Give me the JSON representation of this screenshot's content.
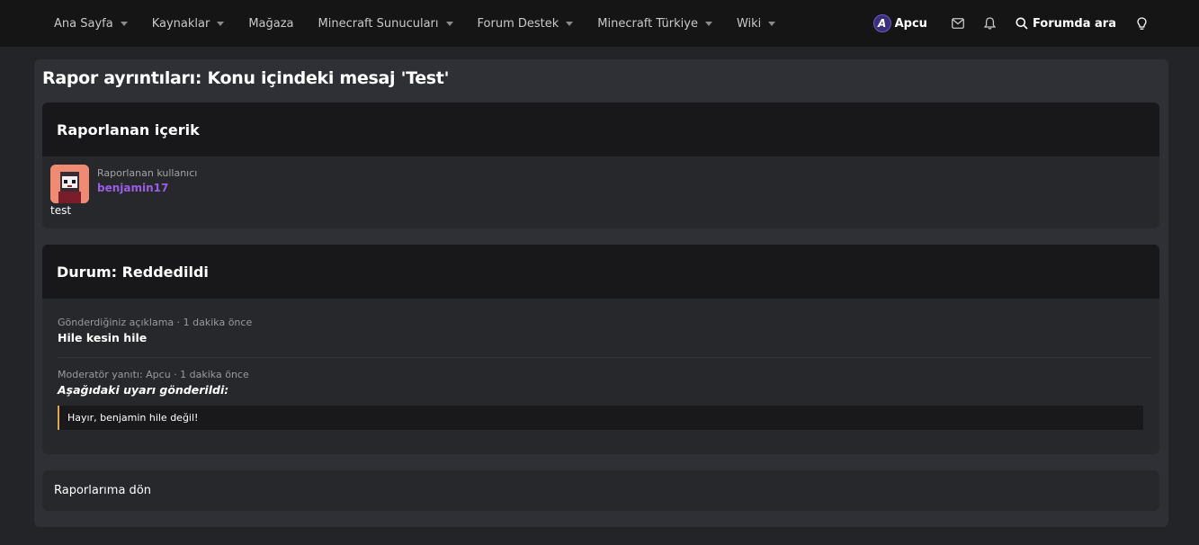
{
  "nav": {
    "items": [
      {
        "label": "Ana Sayfa",
        "has_dropdown": true
      },
      {
        "label": "Kaynaklar",
        "has_dropdown": true
      },
      {
        "label": "Mağaza",
        "has_dropdown": false
      },
      {
        "label": "Minecraft Sunucuları",
        "has_dropdown": true
      },
      {
        "label": "Forum Destek",
        "has_dropdown": true
      },
      {
        "label": "Minecraft Türkiye",
        "has_dropdown": true
      },
      {
        "label": "Wiki",
        "has_dropdown": true
      }
    ],
    "user": {
      "name": "Apcu",
      "avatar_letter": "A"
    },
    "search_label": "Forumda ara",
    "icons": [
      "envelope-icon",
      "bell-icon",
      "search-icon",
      "lightbulb-icon"
    ]
  },
  "page": {
    "title": "Rapor ayrıntıları: Konu içindeki mesaj 'Test'"
  },
  "reported": {
    "header": "Raporlanan içerik",
    "label": "Raporlanan kullanıcı",
    "username": "benjamin17",
    "content": "test"
  },
  "status": {
    "header": "Durum: Reddedildi",
    "comments": [
      {
        "meta": "Gönderdiğiniz açıklama · 1 dakika önce",
        "text": "Hile kesin hile"
      },
      {
        "meta": "Moderatör yanıtı: Apcu · 1 dakika önce",
        "text": "Aşağıdaki uyarı gönderildi:"
      }
    ],
    "quote": "Hayır, benjamin hile değil!"
  },
  "footer": {
    "back_label": "Raporlarıma dön"
  },
  "colors": {
    "accent_username": "#9b5de5",
    "quote_border": "#e0a84a",
    "nav_bg": "#151515",
    "page_bg": "#232428"
  }
}
